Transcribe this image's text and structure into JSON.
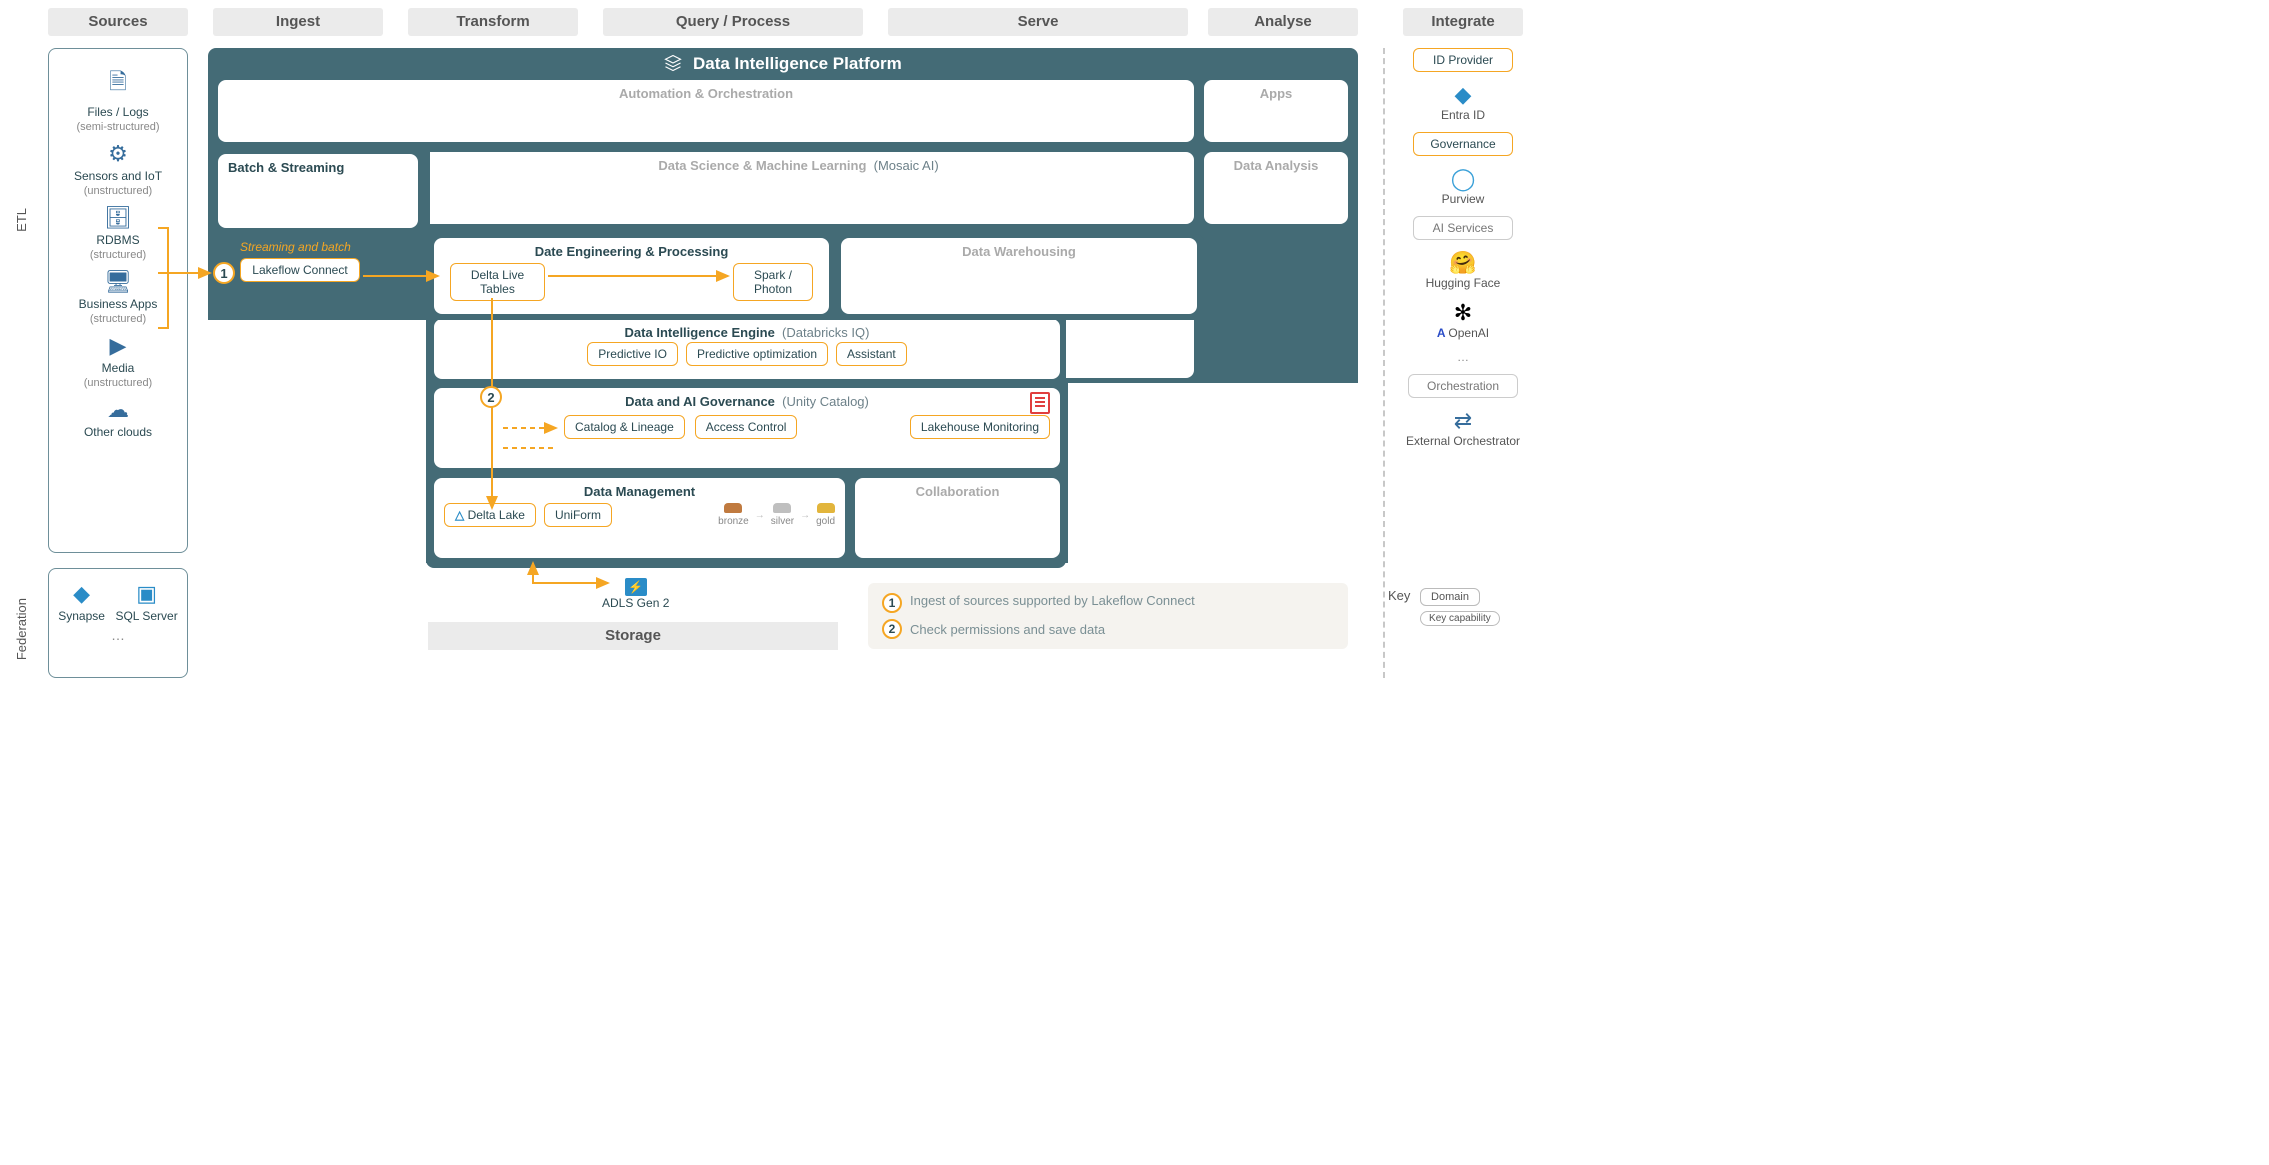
{
  "columns": {
    "sources": "Sources",
    "ingest": "Ingest",
    "transform": "Transform",
    "query": "Query / Process",
    "serve": "Serve",
    "analyse": "Analyse",
    "integrate": "Integrate"
  },
  "rails": {
    "etl": "ETL",
    "federation": "Federation"
  },
  "sources": {
    "files": {
      "label": "Files / Logs",
      "sub": "(semi-structured)"
    },
    "iot": {
      "label": "Sensors and IoT",
      "sub": "(unstructured)"
    },
    "rdbms": {
      "label": "RDBMS",
      "sub": "(structured)"
    },
    "apps": {
      "label": "Business Apps",
      "sub": "(structured)"
    },
    "media": {
      "label": "Media",
      "sub": "(unstructured)"
    },
    "clouds": {
      "label": "Other clouds"
    }
  },
  "federation": {
    "synapse": "Synapse",
    "sqlserver": "SQL Server",
    "more": "…"
  },
  "platform_title": "Data Intelligence Platform",
  "panels": {
    "automation": "Automation & Orchestration",
    "apps": "Apps",
    "batch": "Batch & Streaming",
    "dsml": "Data Science & Machine Learning",
    "dsml_paren": "(Mosaic AI)",
    "analysis": "Data Analysis",
    "dep": "Date Engineering & Processing",
    "dwh": "Data Warehousing",
    "die": "Data Intelligence Engine",
    "die_paren": "(Databricks IQ)",
    "gov": "Data and AI Governance",
    "gov_paren": "(Unity Catalog)",
    "dm": "Data Management",
    "collab": "Collaboration"
  },
  "annotations": {
    "streaming_batch": "Streaming and batch"
  },
  "chips": {
    "lakeflow": "Lakeflow Connect",
    "dlt": "Delta Live Tables",
    "spark": "Spark / Photon",
    "pio": "Predictive IO",
    "popt": "Predictive optimization",
    "assistant": "Assistant",
    "catalog": "Catalog & Lineage",
    "access": "Access Control",
    "monitor": "Lakehouse Monitoring",
    "delta": "Delta Lake",
    "uniform": "UniForm"
  },
  "medallion": {
    "bronze": "bronze",
    "silver": "silver",
    "gold": "gold"
  },
  "storage": {
    "adls": "ADLS Gen 2",
    "label": "Storage"
  },
  "steps": {
    "s1": "1",
    "s1_text": "Ingest of sources supported by Lakeflow Connect",
    "s2": "2",
    "s2_text": "Check permissions and save data"
  },
  "integrate": {
    "id_provider": "ID Provider",
    "entra": "Entra ID",
    "governance": "Governance",
    "purview": "Purview",
    "ai_services": "AI Services",
    "hf": "Hugging Face",
    "openai": "OpenAI",
    "more": "…",
    "orchestration": "Orchestration",
    "ext_orch": "External Orchestrator"
  },
  "legend": {
    "key": "Key",
    "domain": "Domain",
    "capability": "Key capability"
  }
}
